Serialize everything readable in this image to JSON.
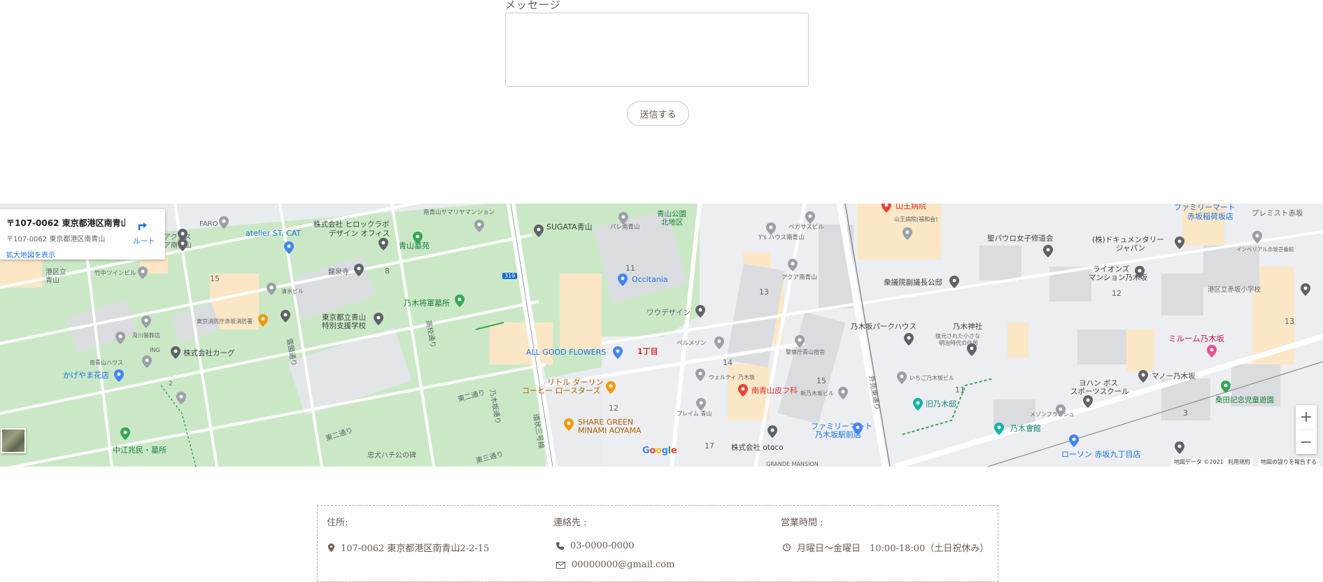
{
  "form": {
    "message_label": "メッセージ",
    "message_value": "",
    "submit_label": "送信する"
  },
  "map": {
    "card": {
      "title": "〒107-0062 東京都港区南青山...",
      "address": "〒107-0062 東京都港区南青山",
      "route_label": "ルート",
      "enlarge_link": "拡大地図を表示"
    },
    "places": {
      "axis": "アクシス",
      "aoyama": "ア南青山",
      "faro": "FARO",
      "atelier": "atelier ST. CAT",
      "hiroku_1": "株式会社 ヒロックラボ",
      "hiroku_2": "デザイン オフィス",
      "aoyama_cemetery": "青山墓苑",
      "minami_samariya": "南青山サマリヤマンション",
      "sugata": "SUGATA青山",
      "palais": "パレ南青山",
      "park_1": "青山公園",
      "park_2": "北地区",
      "y_house": "Y's ハウス南青山",
      "pegasus": "ペガサスビル",
      "sanno": "山王病院",
      "sanno_sub": "山王病院(福和会)",
      "famima_akasaka_1": "ファミリーマート",
      "famima_akasaka_2": "赤坂稲荷坂店",
      "premist": "プレミスト赤坂",
      "paulo_1": "聖パウロ女子修道会",
      "document_1": "(株)ドキュメンタリー",
      "document_2": "ジャパン",
      "imperial": "インペリアル赤坂壱番館",
      "minato_ward": "港区立",
      "aoyama_label": "青山",
      "takenoichi": "竹中ツインビル",
      "ryusenji": "龍泉寺",
      "shimizu": "清水ビル",
      "occitania": "Occitania",
      "agua": "アクア南青山",
      "shugiin": "衆議院副議長公邸",
      "lions_1": "ライオンズ",
      "lions_2": "マンション乃木坂",
      "akasaka_school": "港区立赤坂小学校",
      "nogi_cemetery": "乃木将軍墓所",
      "fire_station": "東京消防庁赤坂消防署",
      "special_school_1": "東京都立青山",
      "special_school_2": "特別支援学校",
      "wadesign": "ワウデザイン",
      "nogizaka_park": "乃木坂パークハウス",
      "nogi_shrine": "乃木神社",
      "nogi_shrine_sub_1": "復元された小さな",
      "nogi_shrine_sub_2": "明治時代の住居",
      "oikawa": "及川装飾店",
      "kagu": "株式会社カーグ",
      "minami_aoyama_house": "南青山ハウス",
      "ing": "ING",
      "kaguyama": "かげやま花店",
      "all_good": "ALL GOOD FLOWERS",
      "itchome": "1丁目",
      "belle": "ベルメゾン",
      "police": "警察庁青山宿舎",
      "milroom": "ミルーム乃木坂",
      "little_1": "リトル ダーリン",
      "little_2": "コーヒー ロースターズ",
      "welty": "ウェルティ 乃木坂",
      "dermatology": "南青山皮フ科",
      "shin_nogi": "新乃木坂ビル",
      "ichigo": "いちご乃木坂ビル",
      "kyu_nogi": "旧乃木邸",
      "johan_1": "ヨハン ボス",
      "johan_2": "スポーツスクール",
      "manor": "マノー乃木坂",
      "kuwata": "桑田記念児童遊園",
      "prime": "プレイム 青山",
      "share_1": "SHARE GREEN",
      "share_2": "MINAMI AOYAMA",
      "mesonfrance": "メゾンフランシュ",
      "nogi_hall": "乃木會館",
      "famima_nogi_1": "ファミリーマート",
      "famima_nogi_2": "乃木坂駅前店",
      "otoco": "株式会社 otoco",
      "lawson": "ローソン 赤坂九丁目店",
      "chuko": "中江兆民・墓所",
      "chuken": "忠犬ハチ公の碑",
      "grande": "GRANDE MANSION",
      "bldg": "ビル"
    },
    "roads": {
      "higashi_2a": "東二通り",
      "higashi_2b": "東二通り",
      "higashi_3": "東三通り",
      "nogizaka_dori": "乃木坂通り",
      "kanjo": "環状三号線",
      "route_319": "319",
      "gaien": "外苑東通り",
      "rei_en": "霊園通り",
      "koka": "高校通り"
    },
    "block_numbers": [
      "15",
      "8",
      "11",
      "13",
      "14",
      "12",
      "15",
      "11",
      "12",
      "13",
      "2",
      "3",
      "17"
    ],
    "google_logo": "Google",
    "attribution": {
      "data": "地図データ ©2021",
      "terms": "利用規約",
      "report": "地図の誤りを報告する"
    },
    "zoom_in": "+",
    "zoom_out": "−"
  },
  "contact": {
    "address_head": "住所:",
    "address": "107-0062 東京都港区南青山2-2-15",
    "contact_head": "連絡先 :",
    "phone": "03-0000-0000",
    "email": "00000000@gmail.com",
    "hours_head": "営業時間 :",
    "hours": "月曜日〜金曜日　10:00-18:00（土日祝休み）"
  },
  "colors": {
    "text_brown": "#6b5a50",
    "map_background": "#e9ecef",
    "park_green": "#c8e6c9",
    "building_beige": "#fde9c9",
    "link_blue": "#1a73e8"
  }
}
